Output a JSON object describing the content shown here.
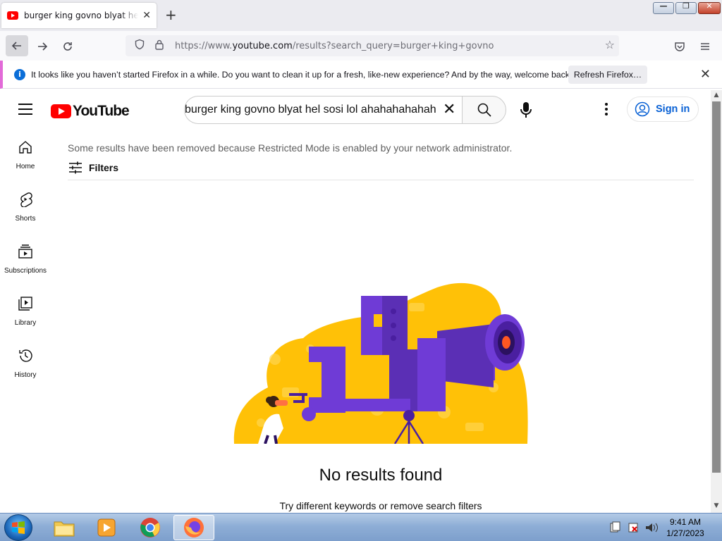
{
  "browser": {
    "tab_title": "burger king govno blyat hel sos",
    "url_prefix": "https://www.",
    "url_domain": "youtube.com",
    "url_path": "/results?search_query=burger+king+govno",
    "notification_text": "It looks like you haven’t started Firefox in a while. Do you want to clean it up for a fresh, like-new experience? And by the way, welcome back!",
    "refresh_button": "Refresh Firefox…"
  },
  "youtube": {
    "logo_text": "YouTube",
    "search_query": "burger king govno blyat hel sosi lol ahahahahahah",
    "signin_label": "Sign in",
    "guide": [
      {
        "label": "Home",
        "icon": "home-icon"
      },
      {
        "label": "Shorts",
        "icon": "shorts-icon"
      },
      {
        "label": "Subscriptions",
        "icon": "subscriptions-icon"
      },
      {
        "label": "Library",
        "icon": "library-icon"
      },
      {
        "label": "History",
        "icon": "history-icon"
      }
    ],
    "restricted_notice": "Some results have been removed because Restricted Mode is enabled by your network administrator.",
    "filters_label": "Filters",
    "no_results_title": "No results found",
    "no_results_hint": "Try different keywords or remove search filters"
  },
  "taskbar": {
    "time": "9:41 AM",
    "date": "1/27/2023"
  },
  "colors": {
    "youtube_red": "#ff0000",
    "link_blue": "#065fd4",
    "illustration_yellow": "#ffc107",
    "illustration_purple": "#6f3bd6"
  }
}
